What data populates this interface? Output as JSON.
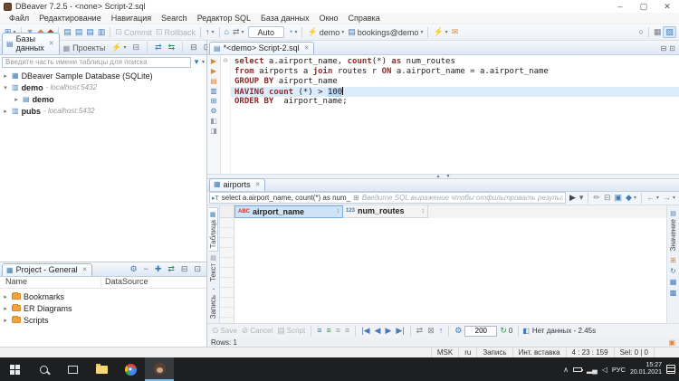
{
  "colors": {
    "accent": "#3e7ab8",
    "orange": "#e0872f",
    "keyword": "#8f2a2a",
    "current_line": "#ddecfb",
    "header_selected": "#cfe3f6"
  },
  "window": {
    "title": "DBeaver 7.2.5 - <none> Script-2.sql"
  },
  "menubar": {
    "items": [
      "Файл",
      "Редактирование",
      "Навигация",
      "Search",
      "Редактор SQL",
      "База данных",
      "Окно",
      "Справка"
    ]
  },
  "toolbar": {
    "buttons": [
      {
        "n": "new-connection-button",
        "g": "⊞",
        "c": "#3e7ab8",
        "dd": true
      },
      {
        "type": "sep"
      },
      {
        "n": "pin-button",
        "g": "▼",
        "c": "#9aa0a6"
      },
      {
        "n": "connect-button",
        "g": "◆",
        "c": "#e0872f"
      },
      {
        "n": "disconnect-button",
        "g": "◆",
        "c": "#c0392b"
      },
      {
        "type": "sep"
      },
      {
        "n": "open-sql-editor-button",
        "g": "▤",
        "c": "#3e7ab8"
      },
      {
        "n": "new-sql-editor-button",
        "g": "▤",
        "c": "#3e7ab8"
      },
      {
        "n": "recent-sql-editor-button",
        "g": "▤",
        "c": "#3e7ab8"
      },
      {
        "n": "sql-console-button",
        "g": "▥",
        "c": "#3e7ab8"
      },
      {
        "type": "sep"
      },
      {
        "n": "commit-button",
        "g": "⊡",
        "t": "Commit",
        "disabled": true
      },
      {
        "n": "rollback-button",
        "g": "⊡",
        "t": "Rollback",
        "disabled": true
      },
      {
        "type": "sep"
      },
      {
        "n": "transaction-mode-button",
        "g": "↑",
        "c": "#556",
        "dd": true
      },
      {
        "type": "sep"
      },
      {
        "n": "schema-browser-button",
        "g": "⌂",
        "c": "#3e7ab8"
      },
      {
        "n": "data-transfer-button",
        "g": "⇄",
        "c": "#778",
        "dd": true
      },
      {
        "type": "combo",
        "n": "autocommit-select",
        "t": "Auto"
      },
      {
        "n": "commit-mode-button",
        "g": "◔",
        "c": "#3e7ab8",
        "dd": true
      },
      {
        "type": "sep"
      },
      {
        "n": "connection-select",
        "g": "⚡",
        "c": "#667",
        "t": "demo",
        "dd": true
      },
      {
        "n": "database-select",
        "g": "▤",
        "c": "#3e7ab8",
        "t": "bookings@demo",
        "dd": true
      },
      {
        "type": "sep"
      },
      {
        "n": "run-task-button",
        "g": "⚡",
        "c": "#e0a13c",
        "dd": true
      },
      {
        "n": "feedback-button",
        "g": "✉",
        "c": "#e0872f"
      }
    ],
    "right_buttons": [
      {
        "n": "search-button",
        "g": "○",
        "c": "#556"
      },
      {
        "type": "sep"
      },
      {
        "n": "open-perspective-button",
        "g": "▦",
        "c": "#778"
      },
      {
        "n": "dbeaver-perspective-button",
        "g": "▨",
        "c": "#3e7ab8",
        "active": true
      }
    ]
  },
  "navigator": {
    "tab_databases": "Базы данных",
    "tab_projects": "Проекты",
    "tab_buttons": [
      {
        "n": "nav-new-connection-button",
        "g": "⚡",
        "c": "#e0872f",
        "dd": true
      },
      {
        "n": "nav-collapse-all-button",
        "g": "⊟",
        "c": "#778"
      },
      {
        "type": "sep"
      },
      {
        "n": "nav-back-button",
        "g": "⇄",
        "c": "#3e7ab8"
      },
      {
        "n": "nav-link-editor-button",
        "g": "⇆",
        "c": "#2e8b57"
      },
      {
        "type": "sep"
      },
      {
        "n": "nav-minimize-button",
        "g": "⊟",
        "c": "#667"
      },
      {
        "n": "nav-maximize-button",
        "g": "⊡",
        "c": "#667"
      }
    ],
    "search_placeholder": "Введите часть имени таблицы для поиска",
    "tree": [
      {
        "label": "DBeaver Sample Database (SQLite)",
        "suffix": "",
        "chev": "▸",
        "icon": "▦",
        "icon_color": "#3e7ab8",
        "level": 0,
        "bold": false
      },
      {
        "label": "demo",
        "suffix": " - localhost:5432",
        "chev": "▾",
        "icon": "▥",
        "icon_color": "#4b84c4",
        "level": 0,
        "bold": true
      },
      {
        "label": "demo",
        "suffix": "",
        "chev": "▸",
        "icon": "▤",
        "icon_color": "#3e7ab8",
        "level": 1,
        "bold": true
      },
      {
        "label": "pubs",
        "suffix": " - localhost:5432",
        "chev": "▸",
        "icon": "▥",
        "icon_color": "#4b84c4",
        "level": 0,
        "bold": true
      }
    ]
  },
  "project_panel": {
    "tab": "Project - General",
    "tab_buttons": [
      {
        "n": "proj-settings-button",
        "g": "⚙",
        "c": "#3e7ab8"
      },
      {
        "n": "proj-collapse-button",
        "g": "−",
        "c": "#667"
      },
      {
        "n": "proj-expand-button",
        "g": "✚",
        "c": "#3e7ab8"
      },
      {
        "n": "proj-link-button",
        "g": "⇄",
        "c": "#2e8b57"
      },
      {
        "n": "proj-minimize-button",
        "g": "⊟",
        "c": "#667"
      },
      {
        "n": "proj-maximize-button",
        "g": "⊡",
        "c": "#667"
      }
    ],
    "columns": [
      "Name",
      "DataSource"
    ],
    "tree": [
      {
        "label": "Bookmarks"
      },
      {
        "label": "ER Diagrams"
      },
      {
        "label": "Scripts"
      }
    ]
  },
  "editor": {
    "tab": "*<demo> Script-2.sql",
    "side_buttons": [
      {
        "n": "execute-statement-button",
        "g": "▶",
        "c": "#e0872f"
      },
      {
        "n": "execute-new-tab-button",
        "g": "▶",
        "c": "#e0872f"
      },
      {
        "n": "execute-script-button",
        "g": "▤",
        "c": "#e0872f"
      },
      {
        "n": "explain-plan-button",
        "g": "▥",
        "c": "#3e7ab8"
      },
      {
        "n": "query-export-button",
        "g": "⊞",
        "c": "#3e7ab8"
      },
      {
        "n": "editor-settings-button",
        "g": "⚙",
        "c": "#3e7ab8"
      },
      {
        "n": "toggle-panel-left-button",
        "g": "◧",
        "c": "#99a"
      },
      {
        "n": "toggle-panel-right-button",
        "g": "◨",
        "c": "#99a"
      }
    ],
    "fold_marker": "⊖",
    "sql_lines": [
      {
        "current": false,
        "fold": true,
        "tokens": [
          [
            "kw",
            "select"
          ],
          [
            "pl",
            " a.airport_name, "
          ],
          [
            "kw",
            "count"
          ],
          [
            "pl",
            "(*) "
          ],
          [
            "kw",
            "as"
          ],
          [
            "pl",
            " num_routes"
          ]
        ]
      },
      {
        "current": false,
        "tokens": [
          [
            "kw",
            "from"
          ],
          [
            "pl",
            " airports a "
          ],
          [
            "kw",
            "join"
          ],
          [
            "pl",
            " routes r "
          ],
          [
            "kw",
            "ON"
          ],
          [
            "pl",
            " a.airport_name = a.airport_name"
          ]
        ]
      },
      {
        "current": false,
        "tokens": [
          [
            "kw",
            "GROUP BY"
          ],
          [
            "pl",
            " airport_name"
          ]
        ]
      },
      {
        "current": true,
        "caret": true,
        "tokens": [
          [
            "kw",
            "HAVING"
          ],
          [
            "pl",
            " "
          ],
          [
            "kw",
            "count"
          ],
          [
            "pl",
            " (*) > "
          ],
          [
            "sel",
            "100"
          ]
        ]
      },
      {
        "current": false,
        "tokens": [
          [
            "kw",
            "ORDER BY"
          ],
          [
            "pl",
            "  airport_name;"
          ]
        ]
      }
    ]
  },
  "splitter": {
    "up": "▲",
    "down": "▼"
  },
  "results": {
    "tab": "airports",
    "filter_prefix": "select a.airport_name, count(*) as num_",
    "filter_expand_icon": "⊞",
    "filter_placeholder": "Введите SQL выражение чтобы отфильтровать результаты",
    "filter_buttons": [
      {
        "n": "apply-filter-button",
        "g": "▶",
        "c": "#445"
      },
      {
        "n": "filter-history-button",
        "g": "▾",
        "c": "#667"
      },
      {
        "type": "sep"
      },
      {
        "n": "clear-filter-button",
        "g": "✏",
        "c": "#889"
      },
      {
        "n": "filter-config-button",
        "g": "⊟",
        "c": "#889"
      },
      {
        "n": "save-filter-button",
        "g": "▣",
        "c": "#3e7ab8"
      },
      {
        "n": "panel-config-button",
        "g": "◆",
        "c": "#3e7ab8",
        "dd": true
      },
      {
        "type": "sep"
      },
      {
        "n": "nav-prev-result-button",
        "g": "←",
        "c": "#889",
        "dd": true
      },
      {
        "n": "nav-next-result-button",
        "g": "→",
        "c": "#889",
        "dd": true
      }
    ],
    "side_tabs": [
      {
        "label": "Таблица",
        "icon": "▦",
        "icon_color": "#3e7ab8",
        "active": true
      },
      {
        "label": "Текст",
        "icon": "▤",
        "icon_color": "#889",
        "active": false
      },
      {
        "label": "Запись",
        "icon": "◔",
        "icon_color": "#3e7ab8",
        "active": false
      }
    ],
    "value_panel": {
      "tab_label": "Значение",
      "tab_icon": "▤",
      "buttons": [
        {
          "n": "value-viewer-button",
          "g": "⊞",
          "c": "#e0872f"
        },
        {
          "n": "value-refresh-button",
          "g": "↻",
          "c": "#3e7ab8"
        },
        {
          "n": "value-grid-button",
          "g": "▦",
          "c": "#3e7ab8"
        },
        {
          "n": "value-metadata-button",
          "g": "▩",
          "c": "#3e7ab8"
        }
      ]
    },
    "columns": [
      {
        "name": "airport_name",
        "type_icon": "ABC",
        "type_color": "#c0392b",
        "sort_icon": "↕",
        "selected": true
      },
      {
        "name": "num_routes",
        "type_icon": "123",
        "type_color": "#3e7ab8",
        "sort_icon": "↕",
        "selected": false
      }
    ],
    "empty_row_count": 13,
    "toolbar": {
      "buttons": [
        {
          "n": "save-button",
          "g": "⊙",
          "t": "Save",
          "disabled": true
        },
        {
          "n": "cancel-button",
          "g": "⊘",
          "t": "Cancel",
          "disabled": true
        },
        {
          "n": "script-button",
          "g": "▤",
          "t": "Script",
          "disabled": true
        },
        {
          "type": "sep"
        },
        {
          "n": "filter-rows-button",
          "g": "≡",
          "c": "#3e7ab8"
        },
        {
          "n": "add-row-button",
          "g": "≡",
          "c": "#2e9e44"
        },
        {
          "n": "duplicate-row-button",
          "g": "≡",
          "c": "#9aa0a6"
        },
        {
          "n": "delete-row-button",
          "g": "≡",
          "c": "#9aa0a6"
        },
        {
          "type": "sep"
        },
        {
          "n": "first-page-button",
          "g": "|◀",
          "c": "#4a7ab5"
        },
        {
          "n": "prev-page-button",
          "g": "◀",
          "c": "#4a7ab5"
        },
        {
          "n": "next-page-button",
          "g": "▶",
          "c": "#4a7ab5"
        },
        {
          "n": "last-page-button",
          "g": "▶|",
          "c": "#4a7ab5"
        },
        {
          "type": "sep"
        },
        {
          "n": "refresh-grid-button",
          "g": "⇄",
          "c": "#889"
        },
        {
          "n": "toggle-panels-button",
          "g": "⊠",
          "c": "#889"
        },
        {
          "n": "export-results-button",
          "g": "↑",
          "c": "#3e7ab8"
        },
        {
          "type": "sep"
        },
        {
          "n": "fetch-settings-button",
          "g": "⚙",
          "c": "#3e7ab8"
        }
      ],
      "fetch_size": "200",
      "refresh_icon": "↻",
      "refresh_count": "0",
      "status_icon": "◧",
      "status": "Нет данных - 2.45s"
    },
    "rows_label": "Rows: 1",
    "clipboard_icon": "▣"
  },
  "statusbar": {
    "items": [
      "MSK",
      "ru",
      "Запись",
      "Инт. вставка",
      "4 : 23 : 159",
      "Sel: 0 | 0"
    ]
  },
  "taskbar": {
    "tray_chevron": "∧",
    "speaker": "◁",
    "lang": "РУС",
    "time": "15:27",
    "date": "20.01.2021"
  }
}
